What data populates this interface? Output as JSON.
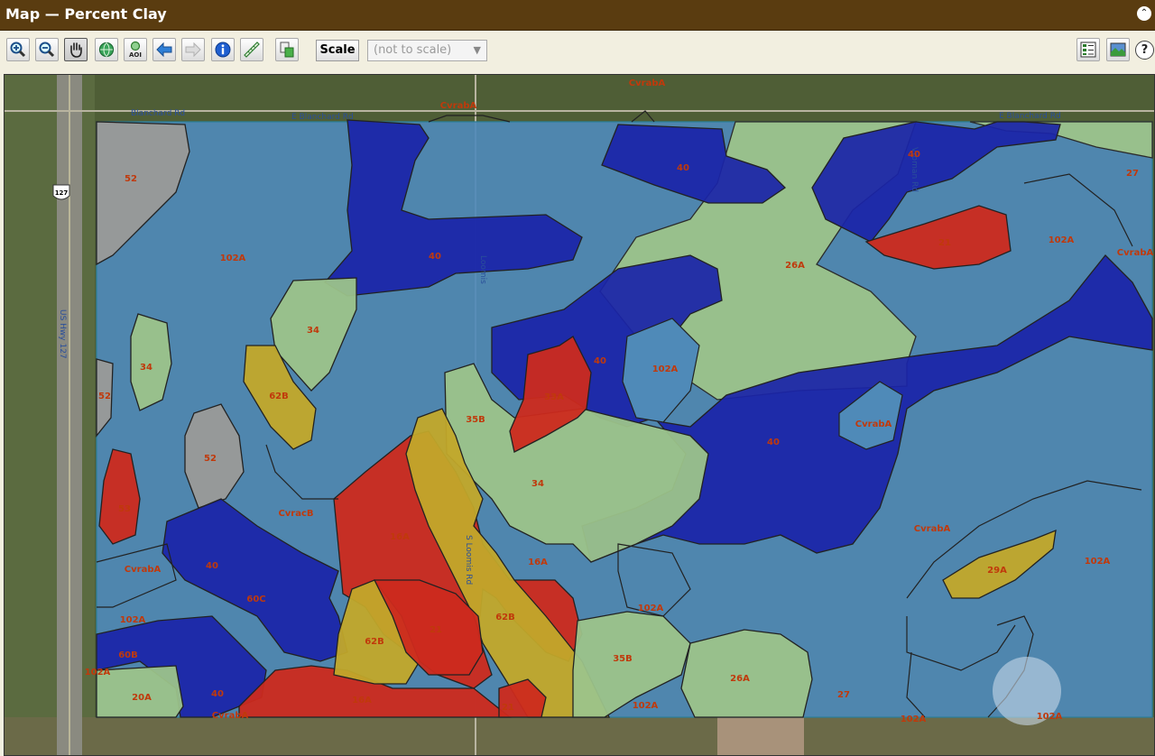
{
  "title_bar": {
    "title": "Map — Percent Clay"
  },
  "toolbar": {
    "tools": [
      {
        "name": "zoom-in-icon"
      },
      {
        "name": "zoom-out-icon"
      },
      {
        "name": "pan-hand-icon"
      },
      {
        "name": "full-extent-globe-icon"
      },
      {
        "name": "zoom-to-aoi-icon",
        "text": "AOI"
      },
      {
        "name": "back-arrow-icon"
      },
      {
        "name": "forward-arrow-icon"
      },
      {
        "name": "identify-info-icon"
      },
      {
        "name": "measure-ruler-icon"
      },
      {
        "name": "clear-selection-icon"
      }
    ],
    "scale_label": "Scale",
    "scale_value": "(not to scale)",
    "right_icons": [
      "legend-toggle-icon",
      "map-view-icon",
      "help-icon"
    ]
  },
  "map": {
    "road_labels": [
      "E Blanchard Rd",
      "Blanchard Rd",
      "E Blanchard Rd",
      "Vroman Rd",
      "Loomis",
      "S Loomis Rd",
      "127",
      "US Hwy 127"
    ],
    "map_unit_labels": [
      "CvrabA",
      "CvrabA",
      "52",
      "102A",
      "40",
      "40",
      "40",
      "21",
      "27",
      "CvrabA",
      "102A",
      "26A",
      "34",
      "34",
      "52",
      "62B",
      "33A",
      "40",
      "102A",
      "35B",
      "CvrabA",
      "40",
      "53",
      "52",
      "CvracB",
      "34",
      "16A",
      "CvrabA",
      "40",
      "16A",
      "60C",
      "102A",
      "CvrabA",
      "29A",
      "102A",
      "102A",
      "21",
      "62B",
      "62B",
      "60B",
      "102A",
      "35B",
      "26A",
      "20A",
      "40",
      "16A",
      "21",
      "CvrabA",
      "102A",
      "27",
      "102A",
      "102A"
    ],
    "legend_colors": {
      "light_blue": "#4f8ab8",
      "dark_blue": "#1a24a8",
      "light_green": "#9cc38a",
      "red": "#cc2a1e",
      "olive": "#c2a82a",
      "gray": "#9a9a98",
      "label": "#c0390b"
    }
  }
}
